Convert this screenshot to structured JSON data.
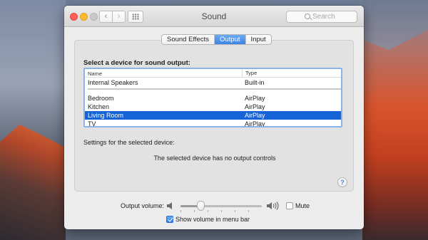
{
  "window": {
    "title": "Sound",
    "search_placeholder": "Search",
    "nav_back": "‹",
    "nav_forward": "›"
  },
  "tabs": [
    {
      "label": "Sound Effects",
      "selected": false
    },
    {
      "label": "Output",
      "selected": true
    },
    {
      "label": "Input",
      "selected": false
    }
  ],
  "output": {
    "heading": "Select a device for sound output:",
    "columns": [
      "Name",
      "Type"
    ],
    "devices": [
      {
        "name": "Internal Speakers",
        "type": "Built-in"
      },
      {
        "name": "Bedroom",
        "type": "AirPlay"
      },
      {
        "name": "Kitchen",
        "type": "AirPlay"
      },
      {
        "name": "Living Room",
        "type": "AirPlay"
      },
      {
        "name": "TV",
        "type": "AirPlay"
      }
    ],
    "selected_device": "Living Room",
    "settings_label": "Settings for the selected device:",
    "no_controls_text": "The selected device has no output controls",
    "help_label": "?"
  },
  "volume": {
    "label": "Output volume:",
    "level": 0.25,
    "mute_label": "Mute",
    "mute_checked": false,
    "menu_bar_label": "Show volume in menu bar",
    "menu_bar_checked": true
  },
  "colors": {
    "accent": "#3d85e6",
    "selection": "#1563d6"
  }
}
